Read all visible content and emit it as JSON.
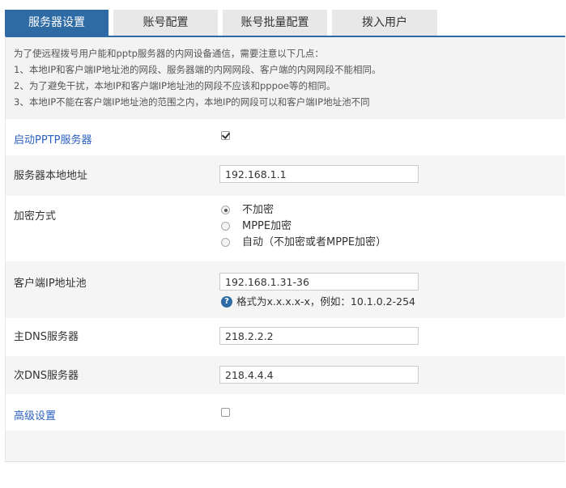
{
  "tabs": [
    {
      "label": "服务器设置",
      "active": true
    },
    {
      "label": "账号配置",
      "active": false
    },
    {
      "label": "账号批量配置",
      "active": false
    },
    {
      "label": "拨入用户",
      "active": false
    }
  ],
  "notice": {
    "lines": [
      "为了使远程拨号用户能和pptp服务器的内网设备通信，需要注意以下几点：",
      "1、本地IP和客户端IP地址池的网段、服务器端的内网网段、客户端的内网网段不能相同。",
      "2、为了避免干扰，本地IP和客户端IP地址池的网段不应该和pppoe等的相同。",
      "3、本地IP不能在客户端IP地址池的范围之内，本地IP的网段可以和客户端IP地址池不同"
    ]
  },
  "form": {
    "enable_pptp": {
      "label": "启动PPTP服务器",
      "checked": true
    },
    "local_address": {
      "label": "服务器本地地址",
      "value": "192.168.1.1"
    },
    "encryption": {
      "label": "加密方式",
      "options": [
        "不加密",
        "MPPE加密",
        "自动（不加密或者MPPE加密）"
      ],
      "selected": "不加密"
    },
    "client_pool": {
      "label": "客户端IP地址池",
      "value": "192.168.1.31-36",
      "help": "格式为x.x.x.x-x，例如：10.1.0.2-254"
    },
    "primary_dns": {
      "label": "主DNS服务器",
      "value": "218.2.2.2"
    },
    "secondary_dns": {
      "label": "次DNS服务器",
      "value": "218.4.4.4"
    },
    "advanced": {
      "label": "高级设置",
      "checked": false
    }
  },
  "colors": {
    "accent": "#2e6ba4",
    "link": "#2b5fc0",
    "stripe": "#f5f5f5"
  },
  "icons": {
    "help": "question-circle-icon"
  }
}
